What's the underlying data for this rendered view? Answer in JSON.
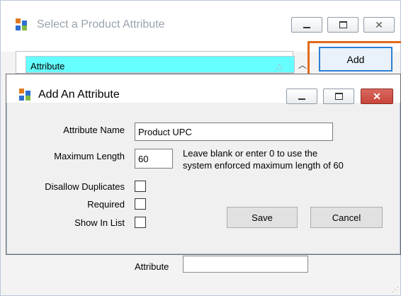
{
  "outer_window": {
    "title": "Select a Product Attribute",
    "grid_header": "Attribute",
    "add_button": "Add",
    "bottom_label": "Attribute",
    "bottom_value": ""
  },
  "dialog": {
    "title": "Add An Attribute",
    "fields": {
      "attribute_name_label": "Attribute Name",
      "attribute_name_value": "Product UPC",
      "max_length_label": "Maximum Length",
      "max_length_value": "60",
      "max_length_hint_line1": "Leave blank or enter 0 to use the",
      "max_length_hint_line2": "system enforced maximum length of 60",
      "disallow_duplicates_label": "Disallow Duplicates",
      "required_label": "Required",
      "show_in_list_label": "Show In List"
    },
    "buttons": {
      "save": "Save",
      "cancel": "Cancel"
    }
  },
  "colors": {
    "highlight": "#e06a1b",
    "grid_header_bg": "#66ffff",
    "add_button_border": "#2c7fd6",
    "dialog_close_bg": "#c8453c"
  }
}
